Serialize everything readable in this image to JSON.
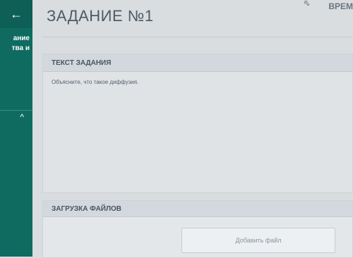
{
  "sidebar": {
    "back_icon": "arrow-left-icon",
    "course_line1": "ание",
    "course_line2": "тва и",
    "collapse_icon": "chevron-up-icon"
  },
  "header": {
    "title": "ЗАДАНИЕ №1",
    "timer_label": "ВРЕМ"
  },
  "task": {
    "section_title": "ТЕКСТ ЗАДАНИЯ",
    "text": "Объясните, что такое диффузия."
  },
  "upload": {
    "section_title": "ЗАГРУЗКА ФАЙЛОВ",
    "add_button_label": "Добавить файл"
  },
  "colors": {
    "sidebar": "#0f6b60",
    "background": "#d9dde0"
  }
}
